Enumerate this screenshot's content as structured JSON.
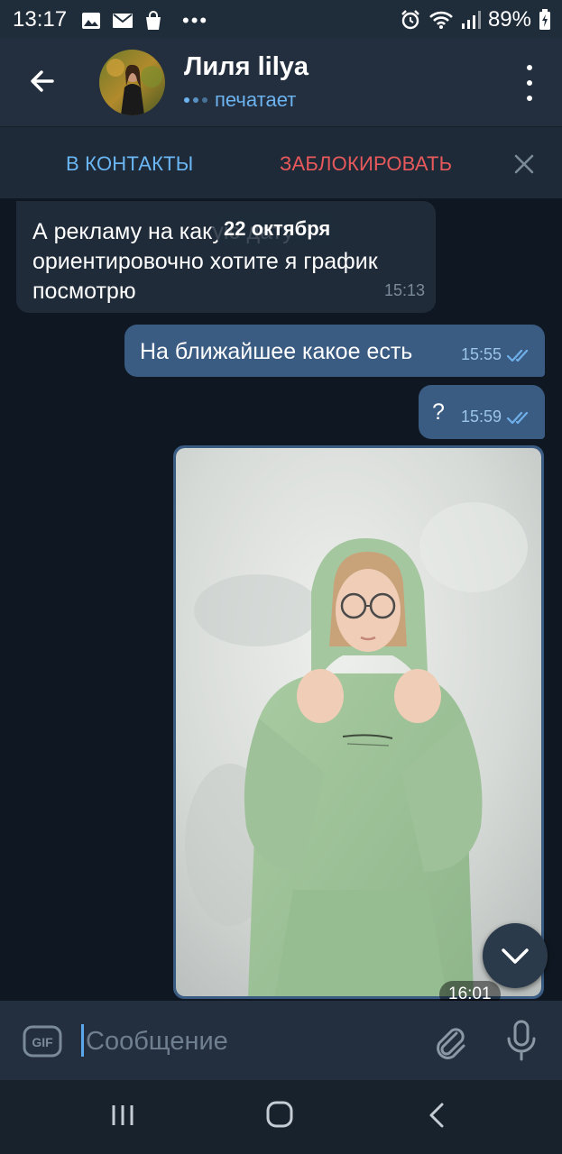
{
  "status_bar": {
    "time": "13:17",
    "more": "•••",
    "battery": "89%",
    "left_icons": [
      "image-icon",
      "mail-icon",
      "shopping-bag-icon"
    ],
    "right_icons": [
      "alarm-icon",
      "wifi-icon",
      "signal-icon",
      "battery-charging-icon"
    ]
  },
  "header": {
    "title": "Лиля lilya",
    "status": "печатает",
    "status_color": "#6cb3ef"
  },
  "action_bar": {
    "add_contact": "В КОНТАКТЫ",
    "block": "ЗАБЛОКИРОВАТЬ",
    "add_color": "#6ab7f4",
    "block_color": "#e8595b"
  },
  "chat": {
    "date_chip": "22 октября",
    "messages": [
      {
        "direction": "incoming",
        "text": "А рекламу на какую дату ориентировочно хотите я график посмотрю",
        "time": "15:13"
      },
      {
        "direction": "outgoing",
        "text": "На ближайшее какое есть",
        "time": "15:55",
        "status": "read"
      },
      {
        "direction": "outgoing",
        "text": "?",
        "time": "15:59",
        "status": "read"
      },
      {
        "direction": "outgoing",
        "type": "photo",
        "time": "16:01"
      }
    ]
  },
  "composer": {
    "gif_label": "GIF",
    "placeholder": "Сообщение"
  },
  "nav": {
    "buttons": [
      "recents-icon",
      "home-icon",
      "back-icon"
    ]
  }
}
